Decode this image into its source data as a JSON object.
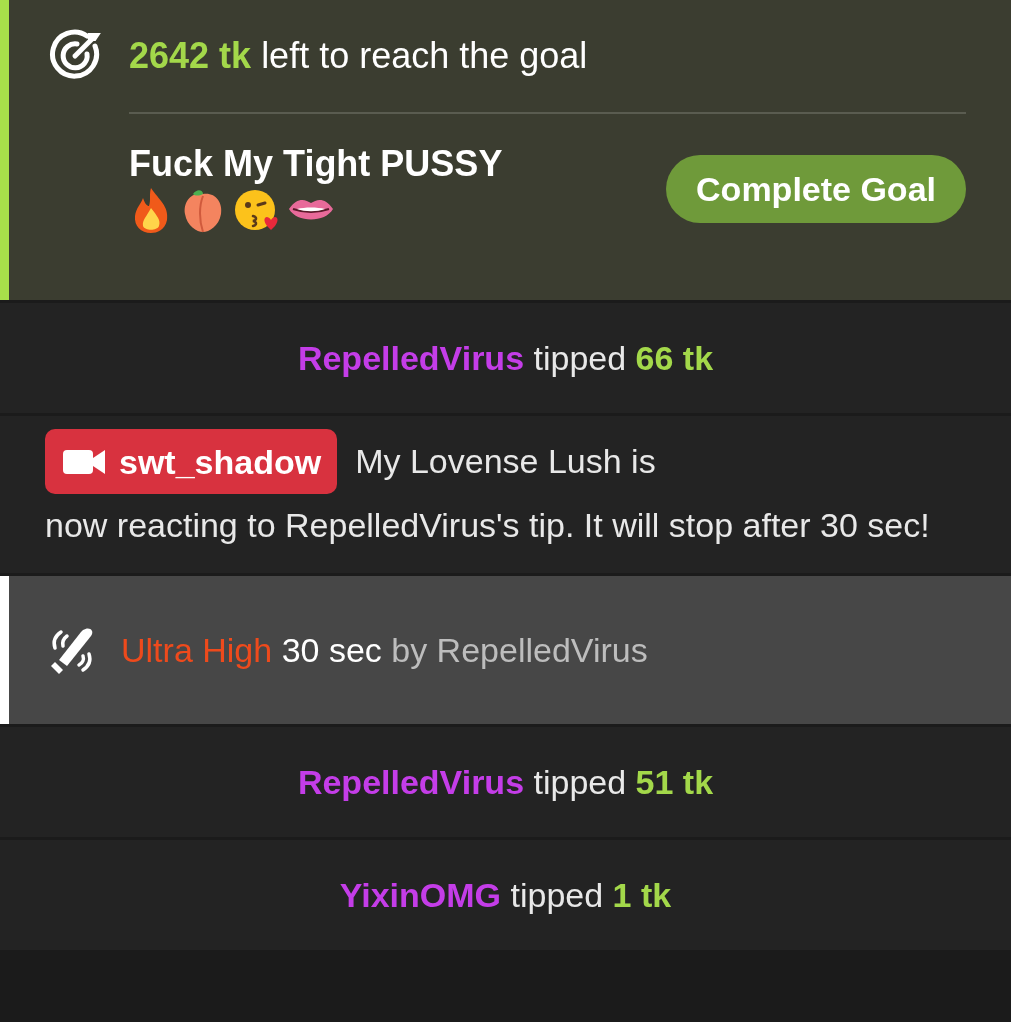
{
  "goal": {
    "amount": "2642 tk",
    "text": "left to reach the goal",
    "title": "Fuck My Tight PUSSY",
    "button": "Complete Goal"
  },
  "feed": [
    {
      "kind": "tip",
      "user": "RepelledVirus",
      "verb": "tipped",
      "amount": "66 tk"
    },
    {
      "kind": "message",
      "user": "swt_shadow",
      "lead": "My Lovense Lush is",
      "text": "now reacting to RepelledVirus's tip. It will stop after 30 sec!"
    },
    {
      "kind": "toy",
      "intensity": "Ultra High",
      "duration": "30 sec",
      "by": "by RepelledVirus"
    },
    {
      "kind": "tip",
      "user": "RepelledVirus",
      "verb": "tipped",
      "amount": "51 tk"
    },
    {
      "kind": "tip",
      "user": "YixinOMG",
      "verb": "tipped",
      "amount": "1 tk"
    }
  ]
}
